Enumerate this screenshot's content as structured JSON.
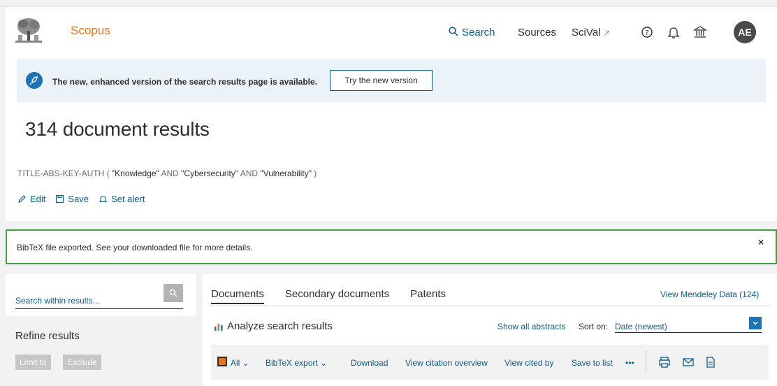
{
  "header": {
    "brand": "Scopus",
    "nav": {
      "search": "Search",
      "sources": "Sources",
      "scival": "SciVal",
      "scival_ext_icon": "external-link-icon"
    },
    "icons": [
      "help-icon",
      "bell-icon",
      "institution-icon"
    ],
    "avatar_initials": "AE"
  },
  "banner": {
    "message": "The new, enhanced version of the search results page is available.",
    "button_label": "Try the new version"
  },
  "results": {
    "title": "314 document results",
    "query": {
      "prefix": "TITLE-ABS-KEY-AUTH (",
      "term1": "\"Knowledge\"",
      "op1": " AND ",
      "term2": "\"Cybersecurity\"",
      "op2": " AND ",
      "term3": "\"Vulnerability\"",
      "suffix": ")"
    },
    "actions": {
      "edit": "Edit",
      "save": "Save",
      "set_alert": "Set alert"
    }
  },
  "alert": {
    "message": "BibTeX file exported. See your downloaded file for more details.",
    "close": "×"
  },
  "sidebar": {
    "search_placeholder": "Search within results...",
    "refine_title": "Refine results",
    "limit_to": "Limit to",
    "exclude": "Exclude"
  },
  "content": {
    "tabs": [
      "Documents",
      "Secondary documents",
      "Patents"
    ],
    "mendeley": "View Mendeley Data (124)",
    "analyze": "Analyze search results",
    "show_abstracts": "Show all abstracts",
    "sort_label": "Sort on:",
    "sort_value": "Date (newest)",
    "toolbar": {
      "all": "All",
      "bibtex_export": "BibTeX export",
      "download": "Download",
      "view_citation_overview": "View citation overview",
      "view_cited_by": "View cited by",
      "save_to_list": "Save to list",
      "more": "•••"
    }
  },
  "colors": {
    "brand_orange": "#e9711c",
    "link_blue": "#0c5c8e",
    "alert_green": "#3fa142"
  }
}
